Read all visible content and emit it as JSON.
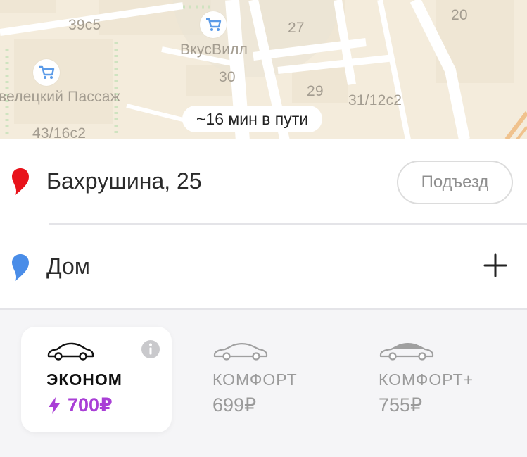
{
  "map": {
    "labels": {
      "b39c5": "39с5",
      "b27": "27",
      "b20": "20",
      "poi": "ВкусВилл",
      "b30": "30",
      "passage": "велецкий Пассаж",
      "b29": "29",
      "b31": "31/12с2",
      "b43": "43/16с2"
    },
    "trip_time": "~16 мин в пути"
  },
  "route": {
    "from": {
      "address": "Бахрушина, 25",
      "pin_color": "#e8131b",
      "entrance_label": "Подъезд"
    },
    "to": {
      "address": "Дом",
      "pin_color": "#4a8de8"
    }
  },
  "tariffs": [
    {
      "name": "ЭКОНОМ",
      "price": "700₽",
      "selected": true,
      "surge_color": "#a93fd6"
    },
    {
      "name": "КОМФОРТ",
      "price": "699₽",
      "selected": false
    },
    {
      "name": "КОМФОРТ+",
      "price": "755₽",
      "selected": false
    }
  ]
}
